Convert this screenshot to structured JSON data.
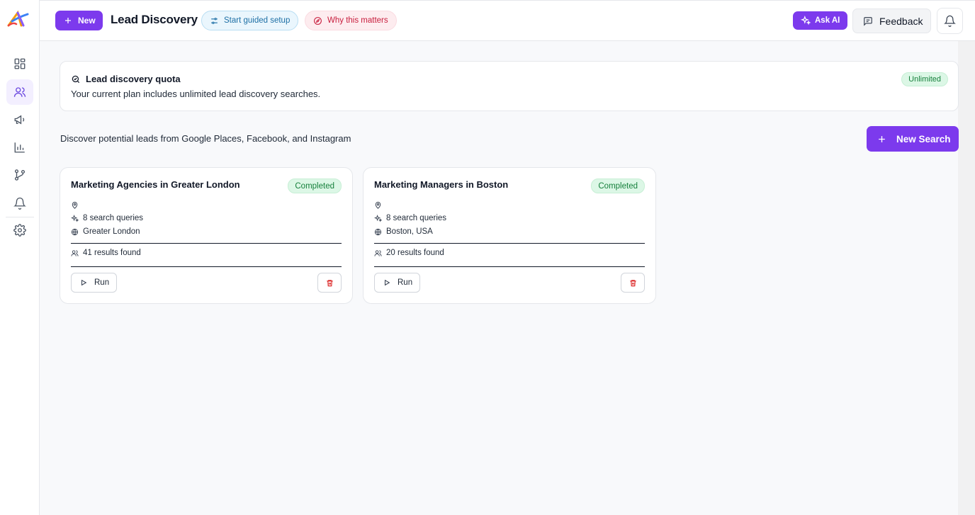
{
  "header": {
    "new_label": "New",
    "title": "Lead Discovery",
    "guided_setup_label": "Start guided setup",
    "why_label": "Why this matters",
    "ask_ai_label": "Ask AI",
    "feedback_label": "Feedback"
  },
  "sidebar": {
    "items": [
      {
        "icon": "dashboard-icon",
        "active": false
      },
      {
        "icon": "users-icon",
        "active": true
      },
      {
        "icon": "megaphone-icon",
        "active": false
      },
      {
        "icon": "bar-chart-icon",
        "active": false
      },
      {
        "icon": "git-branch-icon",
        "active": false
      },
      {
        "icon": "bell-icon",
        "active": false
      },
      {
        "icon": "gear-icon",
        "active": false
      }
    ]
  },
  "quota": {
    "title": "Lead discovery quota",
    "description": "Your current plan includes unlimited lead discovery searches.",
    "badge": "Unlimited"
  },
  "main": {
    "discover_text": "Discover potential leads from Google Places, Facebook, and Instagram",
    "new_search_label": "New Search"
  },
  "cards": [
    {
      "title": "Marketing Agencies in Greater London",
      "status": "Completed",
      "queries": "8 search queries",
      "location": "Greater London",
      "results": "41 results found",
      "run_label": "Run"
    },
    {
      "title": "Marketing Managers in Boston",
      "status": "Completed",
      "queries": "8 search queries",
      "location": "Boston, USA",
      "results": "20 results found",
      "run_label": "Run"
    }
  ],
  "colors": {
    "accent": "#7c3aed",
    "success_bg": "#dcf7e6",
    "success_text": "#16803c",
    "danger": "#dc2626"
  }
}
